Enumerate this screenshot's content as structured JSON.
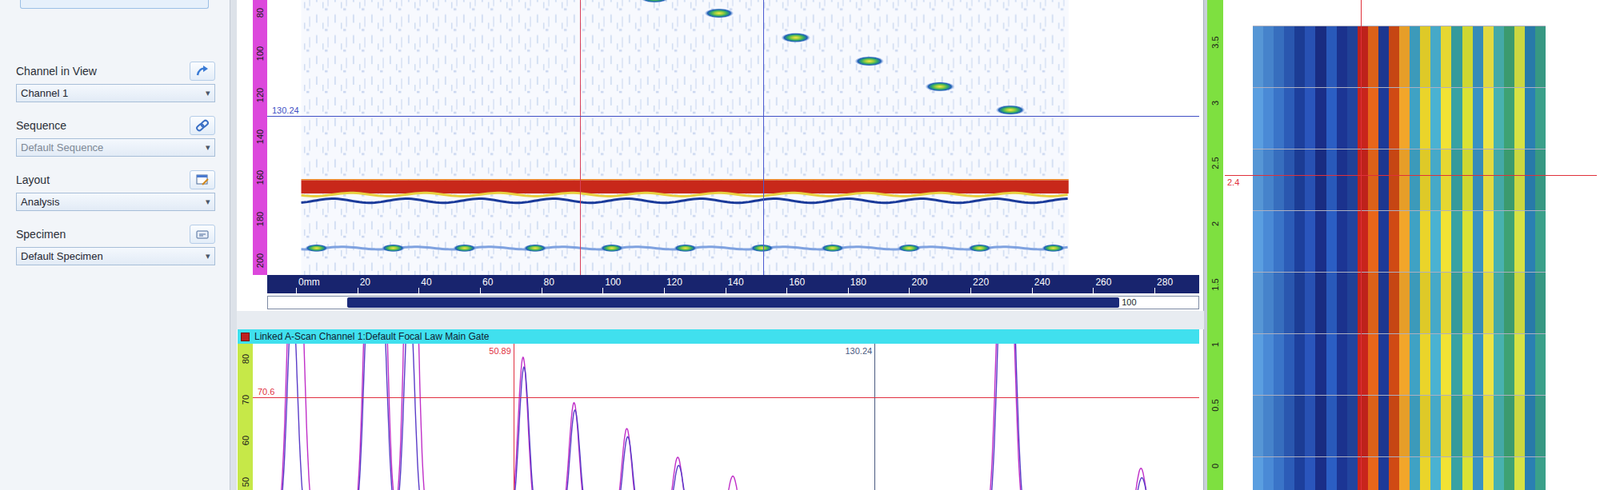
{
  "sidebar": {
    "dropdown_arrow": "▾",
    "fields": [
      {
        "label": "Channel in View",
        "value": "Channel 1",
        "disabled": false
      },
      {
        "label": "Sequence",
        "value": "Default Sequence",
        "disabled": true
      },
      {
        "label": "Layout",
        "value": "Analysis",
        "disabled": false
      },
      {
        "label": "Specimen",
        "value": "Default Specimen",
        "disabled": false
      }
    ]
  },
  "bscan": {
    "depth_ticks": [
      "80",
      "100",
      "120",
      "140",
      "160",
      "180",
      "200"
    ],
    "scan_ticks": [
      "0mm",
      "20",
      "40",
      "60",
      "80",
      "100",
      "120",
      "140",
      "160",
      "180",
      "200",
      "220",
      "240",
      "260",
      "280"
    ],
    "scrollbar": {
      "label": "100",
      "start": 0.085,
      "level": 0.83
    },
    "image": {
      "x_start": 1.7,
      "x_end": 252
    },
    "indications": [
      {
        "x": 117,
        "depth": 73
      },
      {
        "x": 138,
        "depth": 80.4
      },
      {
        "x": 163,
        "depth": 92.2
      },
      {
        "x": 187,
        "depth": 103.6
      },
      {
        "x": 210,
        "depth": 115.9
      },
      {
        "x": 233,
        "depth": 127.2
      }
    ],
    "backwall": {
      "top": 161.2,
      "bottom": 167.6
    },
    "second_echo": {
      "depth": 194,
      "x": [
        6.7,
        31.7,
        55,
        78,
        103,
        127,
        152,
        175,
        200,
        223,
        247
      ]
    },
    "cursors": [
      {
        "axis": "scan",
        "value": 92.7,
        "label": "",
        "color": "#d8405a"
      },
      {
        "axis": "scan",
        "value": 152.3,
        "label": "",
        "color": "#4a5ad0"
      },
      {
        "axis": "depth",
        "value": 130.24,
        "label": "130.24",
        "color": "#3f4fc4"
      }
    ]
  },
  "ascan": {
    "title": "Linked A-Scan Channel 1:Default Focal Law Main Gate",
    "amplitude_ticks": [
      "80",
      "70",
      "60",
      "50"
    ],
    "series": [
      {
        "color": "#c030c8",
        "peaks": [
          [
            2.1,
            100
          ],
          [
            3.9,
            100
          ],
          [
            18.9,
            100
          ],
          [
            20.7,
            100
          ],
          [
            22.2,
            100
          ],
          [
            27.8,
            100
          ],
          [
            29.0,
            100
          ],
          [
            53.0,
            80.4
          ],
          [
            64.2,
            69.3
          ],
          [
            75.8,
            63
          ],
          [
            87.0,
            56
          ],
          [
            99.1,
            51.4
          ],
          [
            157.9,
            100
          ],
          [
            160.1,
            100
          ],
          [
            188.8,
            53.3
          ]
        ]
      },
      {
        "color": "#5a3cc8",
        "peaks": [
          [
            2.3,
            95
          ],
          [
            19.1,
            98
          ],
          [
            22.0,
            96
          ],
          [
            28.0,
            97
          ],
          [
            53.2,
            78
          ],
          [
            64.4,
            67.5
          ],
          [
            76.0,
            61
          ],
          [
            87.2,
            54
          ],
          [
            158.2,
            98
          ],
          [
            160.4,
            97
          ],
          [
            189.0,
            51
          ]
        ]
      }
    ],
    "cursors": [
      {
        "axis": "depth",
        "value": 50.89,
        "label": "50.89",
        "color": "#e03040"
      },
      {
        "axis": "depth",
        "value": 130.24,
        "label": "130.24",
        "color": "#4a5a80"
      },
      {
        "axis": "amplitude",
        "value": 70.6,
        "label": "70.6",
        "color": "#e03040"
      }
    ]
  },
  "cscan": {
    "ticks": [
      "3.5",
      "3",
      "2.5",
      "2",
      "1.5",
      "1",
      "0.5",
      "0"
    ],
    "rows": 8,
    "columns": [
      "#5a9ee0",
      "#4a8ad6",
      "#3a74c8",
      "#2c5cb8",
      "#1d3f9c",
      "#2a55bc",
      "#1a2e88",
      "#2b5ec4",
      "#1c3594",
      "#22449f",
      "#c8241c",
      "#e8661a",
      "#1d3a98",
      "#d04a14",
      "#f2a62a",
      "#3fa2c4",
      "#ead42a",
      "#4ab2d2",
      "#f2e234",
      "#38a2a4",
      "#dae234",
      "#3a92c2",
      "#eee444",
      "#48b2b0",
      "#3ea274",
      "#d6e244",
      "#2a80b2",
      "#3aa08a"
    ],
    "cursors": {
      "vertical": {
        "level": 0.37,
        "color": "#e0303a"
      },
      "horizontal": {
        "value": 2.4,
        "label": "2.4",
        "color": "#e0303a"
      }
    }
  }
}
